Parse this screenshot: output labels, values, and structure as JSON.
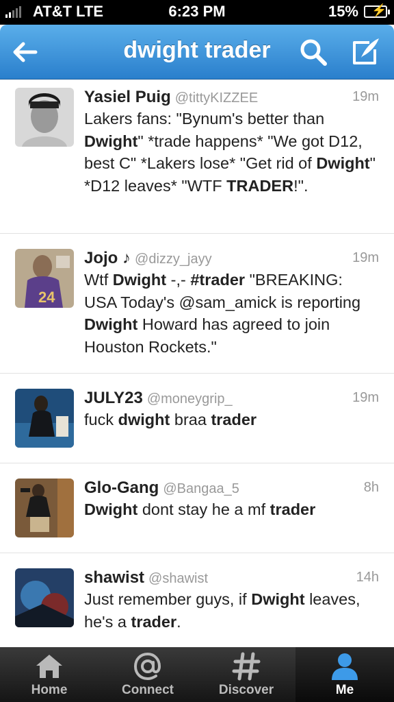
{
  "status_bar": {
    "carrier": "AT&T  LTE",
    "time": "6:23 PM",
    "battery": "15%"
  },
  "nav": {
    "title": "dwight trader",
    "back_icon": "back-arrow-icon",
    "search_icon": "search-icon",
    "compose_icon": "compose-icon"
  },
  "tweets": [
    {
      "name": "Yasiel Puig",
      "handle": "@tittyKIZZEE",
      "time": "19m",
      "segments": [
        {
          "t": "Lakers fans: \"Bynum's better than "
        },
        {
          "t": "Dwight",
          "b": true
        },
        {
          "t": "\" *trade happens* \"We got D12, best C\" *Lakers lose* \"Get rid of "
        },
        {
          "t": "Dwight",
          "b": true
        },
        {
          "t": "\" *D12 leaves* \"WTF "
        },
        {
          "t": "TRADER",
          "b": true
        },
        {
          "t": "!\"."
        }
      ]
    },
    {
      "name": "Jojo ♪",
      "handle": "@dizzy_jayy",
      "time": "19m",
      "segments": [
        {
          "t": "Wtf "
        },
        {
          "t": "Dwight",
          "b": true
        },
        {
          "t": " -,- "
        },
        {
          "t": "#trader",
          "b": true
        },
        {
          "t": "  \"BREAKING: USA Today's @sam_amick is reporting "
        },
        {
          "t": "Dwight",
          "b": true
        },
        {
          "t": " Howard has agreed to join Houston Rockets.\""
        }
      ]
    },
    {
      "name": "JULY23",
      "handle": "@moneygrip_",
      "time": "19m",
      "segments": [
        {
          "t": "fuck "
        },
        {
          "t": "dwight",
          "b": true
        },
        {
          "t": " braa "
        },
        {
          "t": "trader",
          "b": true
        }
      ]
    },
    {
      "name": "Glo-Gang",
      "handle": "@Bangaa_5",
      "time": "8h",
      "segments": [
        {
          "t": "Dwight",
          "b": true
        },
        {
          "t": " dont stay he a mf "
        },
        {
          "t": "trader",
          "b": true
        }
      ]
    },
    {
      "name": "shawist",
      "handle": "@shawist",
      "time": "14h",
      "segments": [
        {
          "t": "Just remember guys, if "
        },
        {
          "t": "Dwight",
          "b": true
        },
        {
          "t": " leaves, he's a "
        },
        {
          "t": "trader",
          "b": true
        },
        {
          "t": "."
        }
      ]
    }
  ],
  "tabs": [
    {
      "label": "Home",
      "icon": "home-icon",
      "active": false
    },
    {
      "label": "Connect",
      "icon": "at-sign-icon",
      "active": false
    },
    {
      "label": "Discover",
      "icon": "hashtag-icon",
      "active": false
    },
    {
      "label": "Me",
      "icon": "person-icon",
      "active": true
    }
  ],
  "colors": {
    "nav_top": "#5aaeea",
    "nav_bottom": "#2a7fcc",
    "active_tab_icon": "#3d9ae8"
  }
}
